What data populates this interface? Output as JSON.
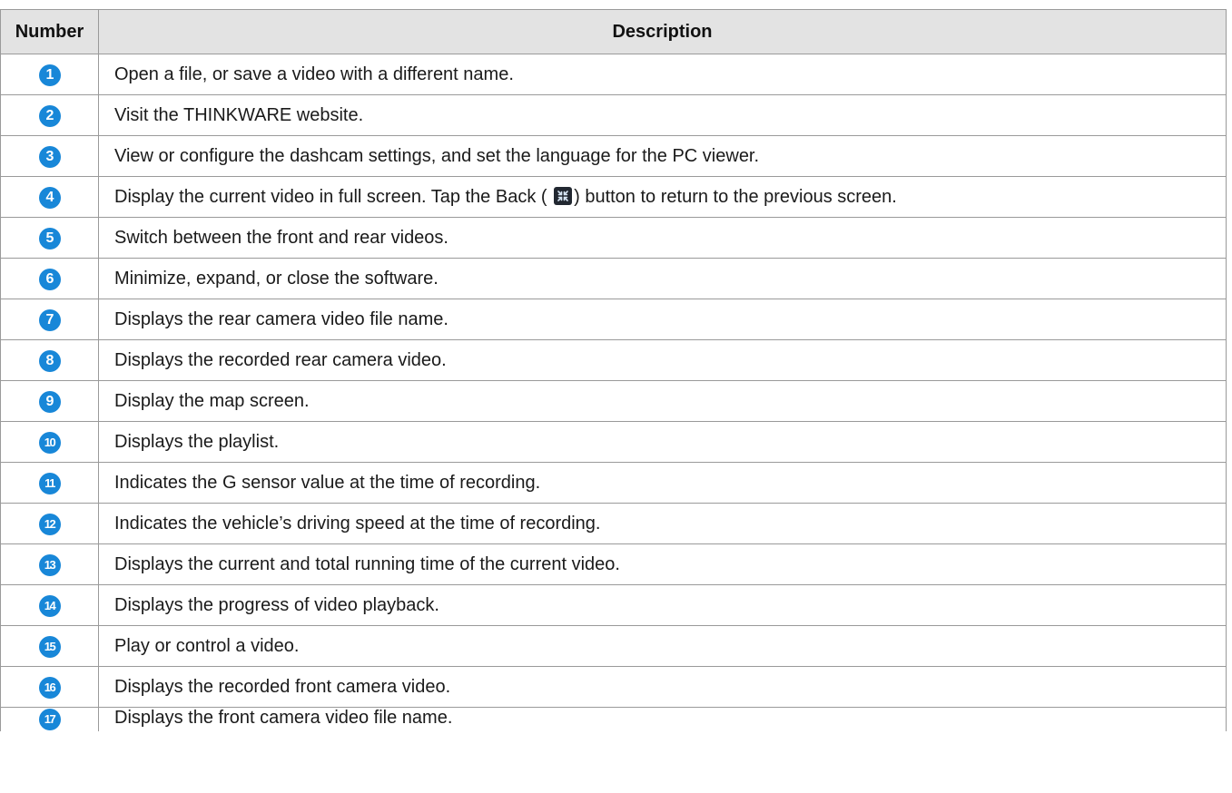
{
  "header": {
    "number": "Number",
    "description": "Description"
  },
  "rows": [
    {
      "number": "1",
      "description": "Open a file, or save a video with a different name."
    },
    {
      "number": "2",
      "description": "Visit the THINKWARE website."
    },
    {
      "number": "3",
      "description": "View or configure the dashcam settings, and set the language for the PC viewer."
    },
    {
      "number": "4",
      "description_before": "Display the current video in full screen. Tap the Back (",
      "icon": "exit-fullscreen-icon",
      "description_after": ") button to return to the previous screen."
    },
    {
      "number": "5",
      "description": "Switch between the front and rear videos."
    },
    {
      "number": "6",
      "description": "Minimize, expand, or close the software."
    },
    {
      "number": "7",
      "description": "Displays the rear camera video file name."
    },
    {
      "number": "8",
      "description": "Displays the recorded rear camera video."
    },
    {
      "number": "9",
      "description": "Display the map screen."
    },
    {
      "number": "10",
      "description": "Displays the playlist."
    },
    {
      "number": "11",
      "description": "Indicates the G sensor value at the time of recording."
    },
    {
      "number": "12",
      "description": "Indicates the vehicle’s driving speed at the time of recording."
    },
    {
      "number": "13",
      "description": "Displays the current and total running time of the current video."
    },
    {
      "number": "14",
      "description": "Displays the progress of video playback."
    },
    {
      "number": "15",
      "description": "Play or control a video."
    },
    {
      "number": "16",
      "description": "Displays the recorded front camera video."
    },
    {
      "number": "17",
      "description": "Displays the front camera video file name."
    }
  ],
  "colors": {
    "badge": "#1887d8",
    "header_bg": "#e3e3e3",
    "border": "#9a9a9a"
  }
}
